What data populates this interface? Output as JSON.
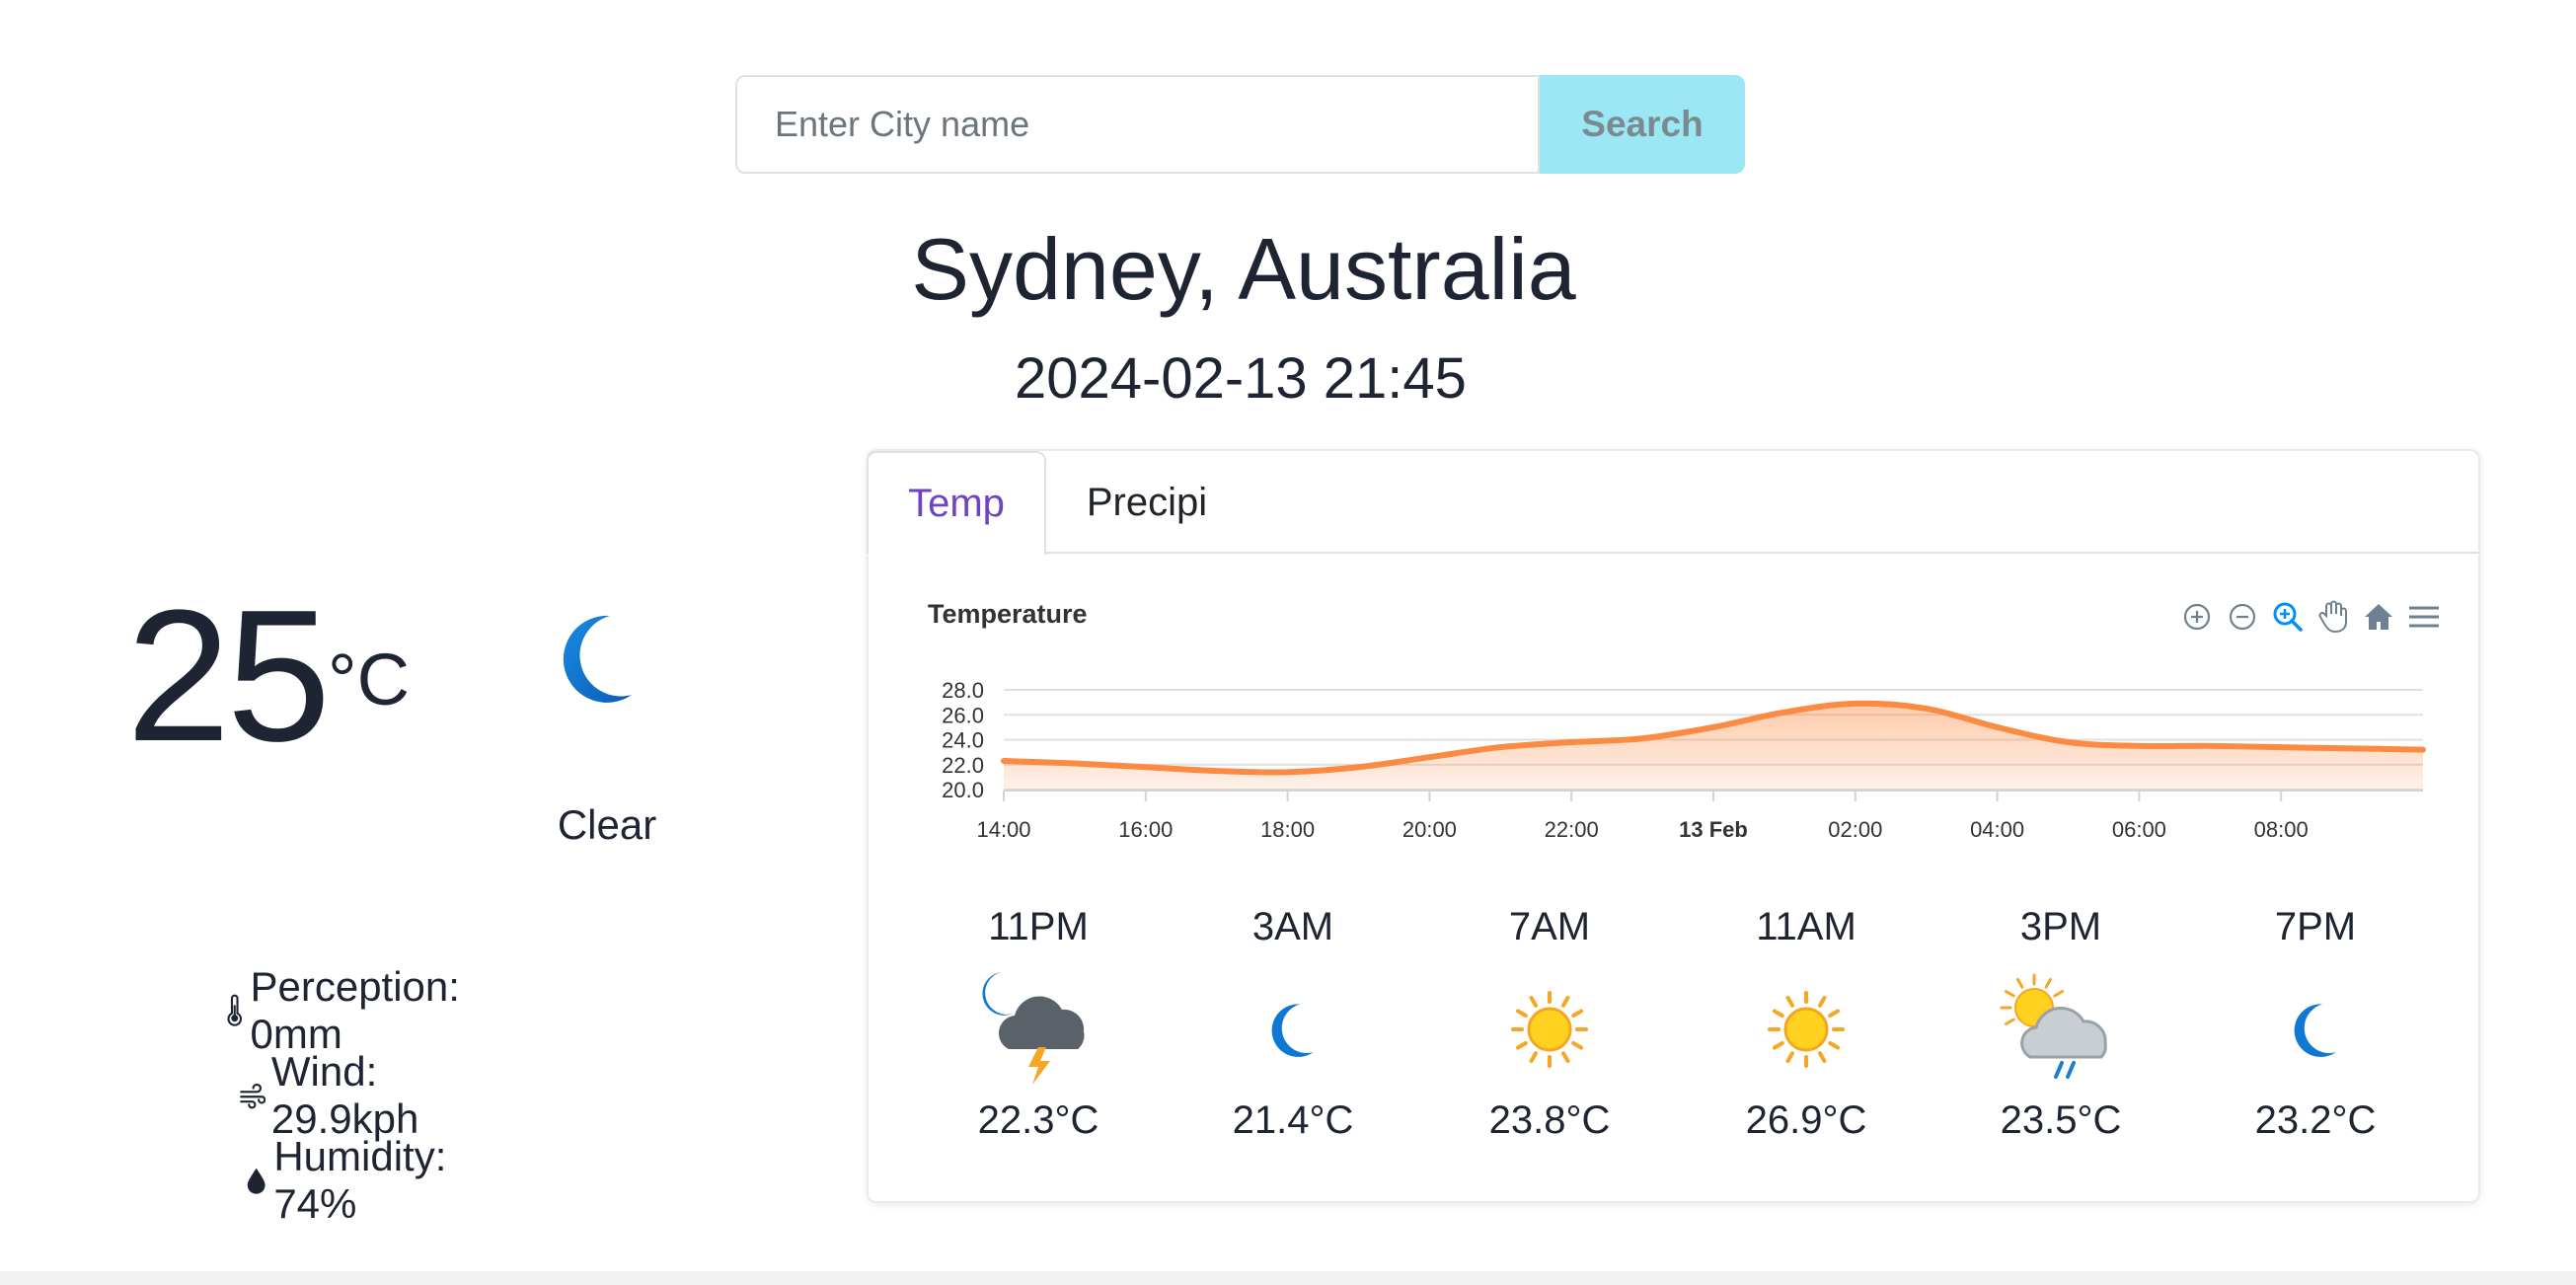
{
  "search": {
    "placeholder": "Enter City name",
    "button_label": "Search"
  },
  "location": {
    "city": "Sydney, Australia",
    "datetime": "2024-02-13 21:45"
  },
  "current": {
    "temperature": "25",
    "unit": "°C",
    "icon": "moon-icon",
    "condition": "Clear",
    "perception": "Perception: 0mm",
    "wind": "Wind: 29.9kph",
    "humidity": "Humidity: 74%"
  },
  "tabs": [
    {
      "label": "Temp",
      "active": true
    },
    {
      "label": "Precipi",
      "active": false
    }
  ],
  "chart": {
    "title": "Temperature",
    "toolbar": [
      "zoom-in-icon",
      "zoom-out-icon",
      "selection-zoom-icon",
      "pan-icon",
      "reset-home-icon",
      "menu-icon"
    ]
  },
  "chart_data": {
    "type": "area",
    "title": "Temperature",
    "xlabel": "",
    "ylabel": "",
    "ylim": [
      20,
      28
    ],
    "y_ticks": [
      "28.0",
      "26.0",
      "24.0",
      "22.0",
      "20.0"
    ],
    "x_ticks": [
      "14:00",
      "16:00",
      "18:00",
      "20:00",
      "22:00",
      "13 Feb",
      "02:00",
      "04:00",
      "06:00",
      "08:00"
    ],
    "x_hours": [
      14,
      16,
      18,
      20,
      22,
      24,
      26,
      28,
      30,
      32
    ],
    "grid": true,
    "color": "#fb8a42",
    "series": [
      {
        "x": [
          14,
          15,
          16,
          17,
          18,
          19,
          20,
          21,
          22,
          23,
          24,
          25,
          26,
          27,
          28,
          29,
          30,
          31,
          32,
          33,
          34
        ],
        "values": [
          22.3,
          22.1,
          21.8,
          21.5,
          21.4,
          21.8,
          22.6,
          23.4,
          23.8,
          24.1,
          25.0,
          26.2,
          26.9,
          26.5,
          25.0,
          23.8,
          23.5,
          23.5,
          23.4,
          23.3,
          23.2
        ]
      }
    ]
  },
  "forecast": [
    {
      "time": "11PM",
      "icon": "moon-thunderstorm-icon",
      "temp": "22.3°C"
    },
    {
      "time": "3AM",
      "icon": "moon-icon",
      "temp": "21.4°C"
    },
    {
      "time": "7AM",
      "icon": "sun-icon",
      "temp": "23.8°C"
    },
    {
      "time": "11AM",
      "icon": "sun-icon",
      "temp": "26.9°C"
    },
    {
      "time": "3PM",
      "icon": "sun-cloud-rain-icon",
      "temp": "23.5°C"
    },
    {
      "time": "7PM",
      "icon": "moon-icon",
      "temp": "23.2°C"
    }
  ]
}
